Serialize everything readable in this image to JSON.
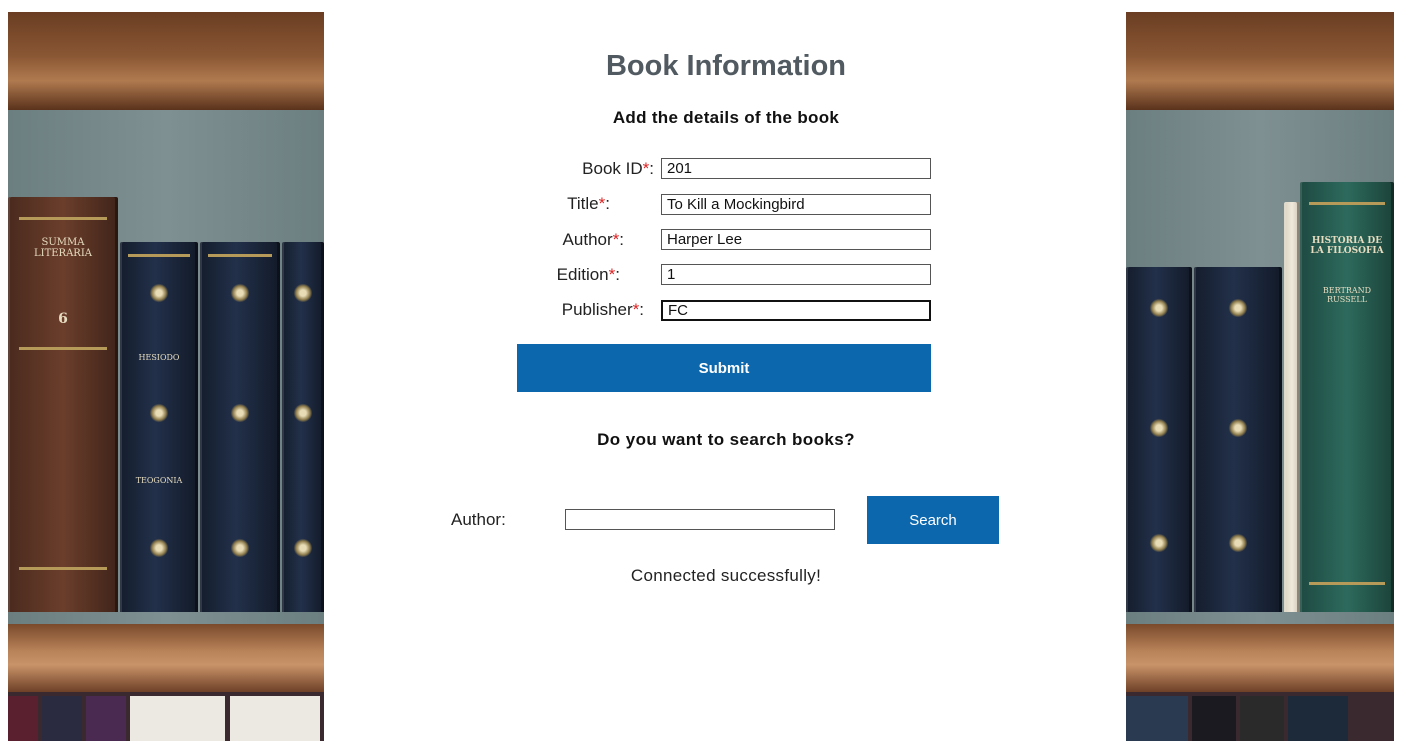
{
  "page": {
    "title": "Book Information",
    "subtitle": "Add the details of the book"
  },
  "form": {
    "required_marker": "*",
    "fields": [
      {
        "label": "Book ID",
        "value": "201"
      },
      {
        "label": "Title",
        "value": "To Kill a Mockingbird"
      },
      {
        "label": "Author",
        "value": "Harper Lee"
      },
      {
        "label": "Edition",
        "value": "1"
      },
      {
        "label": "Publisher",
        "value": "FC"
      }
    ],
    "submit_label": "Submit"
  },
  "search": {
    "heading": "Do you want to search books?",
    "author_label": "Author:",
    "author_value": "",
    "button_label": "Search"
  },
  "status": {
    "message": "Connected successfully!"
  },
  "decor": {
    "left_spines": [
      "SUMMA LITERARIA",
      "6",
      "HESIODO",
      "TEOGONIA"
    ],
    "right_spines": [
      "HISTORIA DE LA FILOSOFIA",
      "BERTRAND RUSSELL"
    ]
  },
  "colors": {
    "accent": "#0d67ad",
    "required": "#dd2222",
    "title": "#505a60"
  }
}
